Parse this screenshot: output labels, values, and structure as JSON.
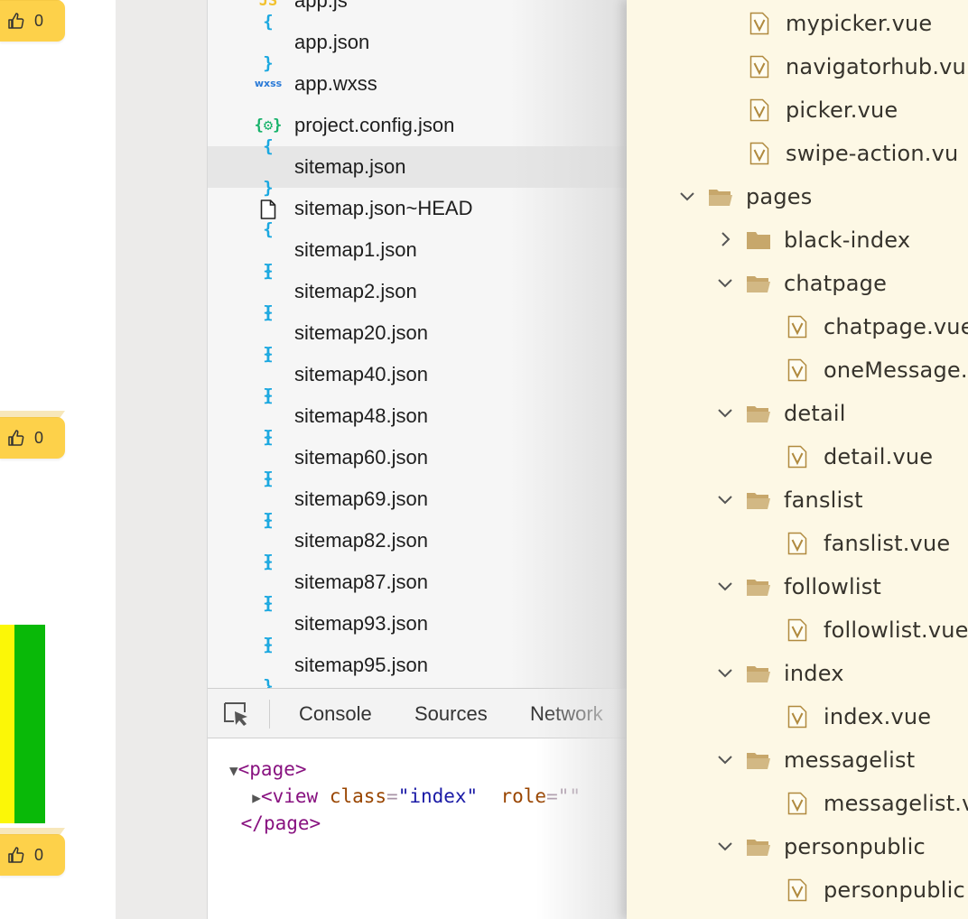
{
  "colors": {
    "badge_bg": "#fdd14a",
    "bar_yellow": "#fbf707",
    "bar_green": "#09b908",
    "file_panel_bg": "#f6f6f6",
    "tree_panel_bg": "#fdf8e5",
    "json_icon": "#1ba8e0",
    "config_icon": "#17b26a",
    "wxss_icon": "#2a7ad7",
    "folder_icon": "#c7a76b"
  },
  "likes": [
    {
      "icon": "thumbs-up-icon",
      "count": "0"
    },
    {
      "icon": "thumbs-up-icon",
      "count": "0"
    },
    {
      "icon": "thumbs-up-icon",
      "count": "0"
    }
  ],
  "files": [
    {
      "icon": "js-icon",
      "glyph": "JS",
      "name": "app.js"
    },
    {
      "icon": "json-icon",
      "glyph": "{ }",
      "name": "app.json"
    },
    {
      "icon": "wxss-icon",
      "glyph": "wxss",
      "name": "app.wxss"
    },
    {
      "icon": "config-json-icon",
      "glyph": "{⚙}",
      "name": "project.config.json"
    },
    {
      "icon": "json-icon",
      "glyph": "{ }",
      "name": "sitemap.json",
      "selected": true
    },
    {
      "icon": "file-icon",
      "glyph": "",
      "name": "sitemap.json~HEAD"
    },
    {
      "icon": "json-icon",
      "glyph": "{ }",
      "name": "sitemap1.json"
    },
    {
      "icon": "json-icon",
      "glyph": "{ }",
      "name": "sitemap2.json"
    },
    {
      "icon": "json-icon",
      "glyph": "{ }",
      "name": "sitemap20.json"
    },
    {
      "icon": "json-icon",
      "glyph": "{ }",
      "name": "sitemap40.json"
    },
    {
      "icon": "json-icon",
      "glyph": "{ }",
      "name": "sitemap48.json"
    },
    {
      "icon": "json-icon",
      "glyph": "{ }",
      "name": "sitemap60.json"
    },
    {
      "icon": "json-icon",
      "glyph": "{ }",
      "name": "sitemap69.json"
    },
    {
      "icon": "json-icon",
      "glyph": "{ }",
      "name": "sitemap82.json"
    },
    {
      "icon": "json-icon",
      "glyph": "{ }",
      "name": "sitemap87.json"
    },
    {
      "icon": "json-icon",
      "glyph": "{ }",
      "name": "sitemap93.json"
    },
    {
      "icon": "json-icon",
      "glyph": "{ }",
      "name": "sitemap95.json"
    }
  ],
  "devtools": {
    "tabs": [
      "Console",
      "Sources",
      "Network"
    ],
    "dom": {
      "page_open": "<page>",
      "view_tag": "<view",
      "view_class_attr": "class",
      "view_class_val": "\"index\"",
      "view_role_attr": "role",
      "view_role_val": "=\"\"",
      "page_close": "</page>"
    }
  },
  "tree": [
    {
      "kind": "file",
      "depth": 1,
      "name": "mypicker.vue"
    },
    {
      "kind": "file",
      "depth": 1,
      "name": "navigatorhub.vu"
    },
    {
      "kind": "file",
      "depth": 1,
      "name": "picker.vue"
    },
    {
      "kind": "file",
      "depth": 1,
      "name": "swipe-action.vu"
    },
    {
      "kind": "folder",
      "depth": 0,
      "expanded": true,
      "name": "pages"
    },
    {
      "kind": "folder",
      "depth": 1,
      "expanded": false,
      "name": "black-index"
    },
    {
      "kind": "folder",
      "depth": 1,
      "expanded": true,
      "name": "chatpage"
    },
    {
      "kind": "file",
      "depth": 2,
      "name": "chatpage.vue"
    },
    {
      "kind": "file",
      "depth": 2,
      "name": "oneMessage."
    },
    {
      "kind": "folder",
      "depth": 1,
      "expanded": true,
      "name": "detail"
    },
    {
      "kind": "file",
      "depth": 2,
      "name": "detail.vue"
    },
    {
      "kind": "folder",
      "depth": 1,
      "expanded": true,
      "name": "fanslist"
    },
    {
      "kind": "file",
      "depth": 2,
      "name": "fanslist.vue"
    },
    {
      "kind": "folder",
      "depth": 1,
      "expanded": true,
      "name": "followlist"
    },
    {
      "kind": "file",
      "depth": 2,
      "name": "followlist.vue"
    },
    {
      "kind": "folder",
      "depth": 1,
      "expanded": true,
      "name": "index"
    },
    {
      "kind": "file",
      "depth": 2,
      "name": "index.vue"
    },
    {
      "kind": "folder",
      "depth": 1,
      "expanded": true,
      "name": "messagelist"
    },
    {
      "kind": "file",
      "depth": 2,
      "name": "messagelist.v"
    },
    {
      "kind": "folder",
      "depth": 1,
      "expanded": true,
      "name": "personpublic"
    },
    {
      "kind": "file",
      "depth": 2,
      "name": "personpublic"
    }
  ]
}
